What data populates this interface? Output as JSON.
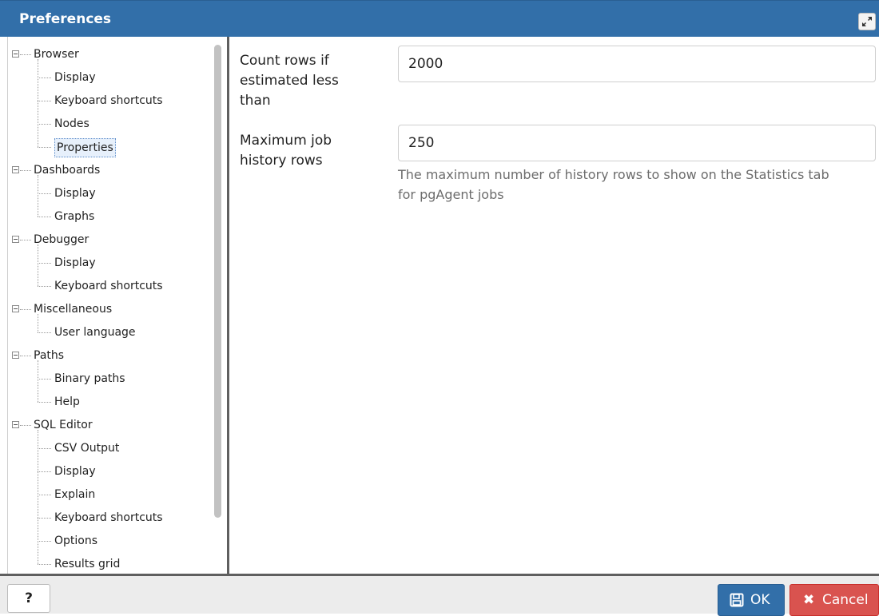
{
  "dialog": {
    "title": "Preferences"
  },
  "tree": {
    "groups": [
      {
        "label": "Browser",
        "children": [
          "Display",
          "Keyboard shortcuts",
          "Nodes",
          "Properties"
        ]
      },
      {
        "label": "Dashboards",
        "children": [
          "Display",
          "Graphs"
        ]
      },
      {
        "label": "Debugger",
        "children": [
          "Display",
          "Keyboard shortcuts"
        ]
      },
      {
        "label": "Miscellaneous",
        "children": [
          "User language"
        ]
      },
      {
        "label": "Paths",
        "children": [
          "Binary paths",
          "Help"
        ]
      },
      {
        "label": "SQL Editor",
        "children": [
          "CSV Output",
          "Display",
          "Explain",
          "Keyboard shortcuts",
          "Options",
          "Results grid"
        ]
      }
    ],
    "selected": "Properties"
  },
  "form": {
    "count_rows": {
      "label_lines": [
        "Count rows if",
        "estimated less",
        "than"
      ],
      "value": "2000"
    },
    "max_job_history": {
      "label_lines": [
        "Maximum job",
        "history rows"
      ],
      "value": "250",
      "help_lines": [
        "The maximum number of history rows to show on the Statistics tab",
        "for pgAgent jobs"
      ]
    }
  },
  "footer": {
    "help_label": "?",
    "ok_label": "OK",
    "cancel_label": "Cancel"
  },
  "colors": {
    "accent": "#326fa9",
    "danger": "#d9534f",
    "footer_bg": "#ececec"
  },
  "icons": {
    "maximize": "expand-icon",
    "ok": "save-icon",
    "cancel": "times-icon"
  }
}
